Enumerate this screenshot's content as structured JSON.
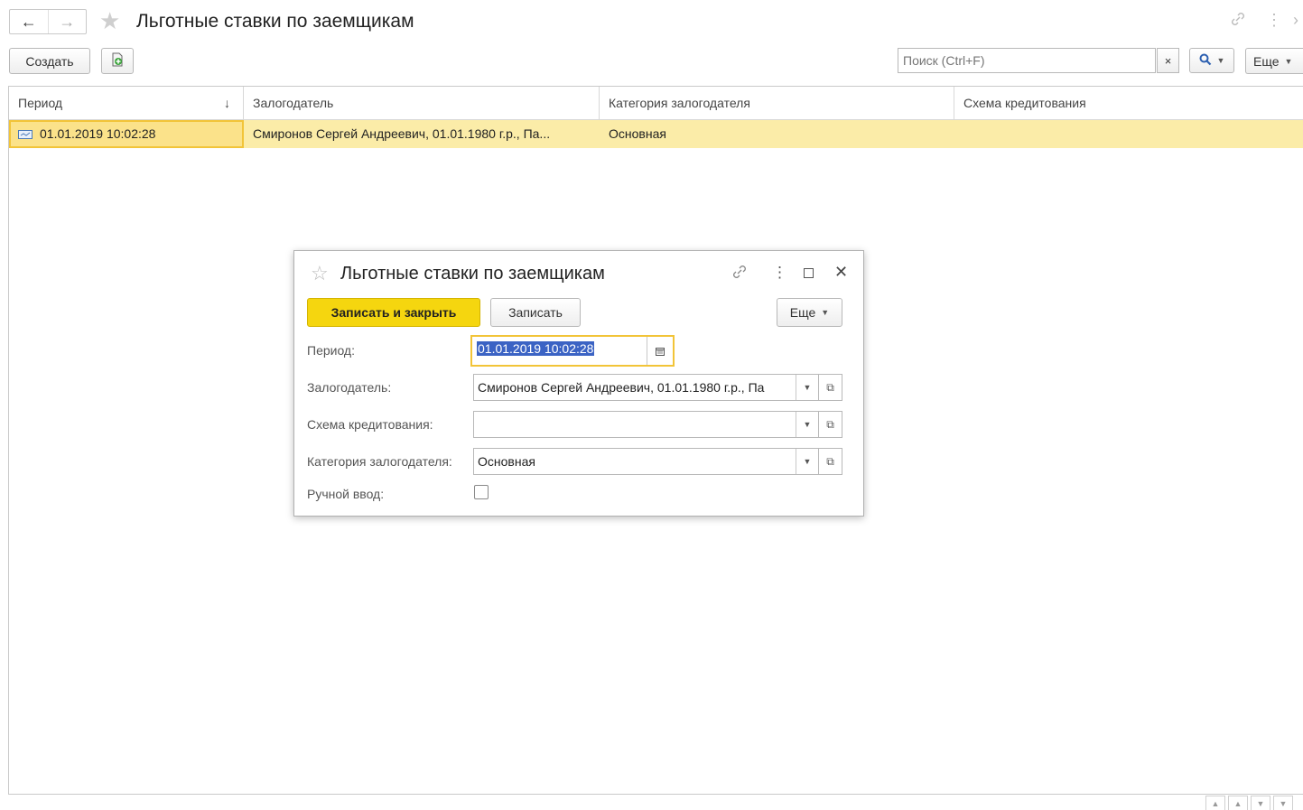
{
  "window": {
    "title": "Льготные ставки по заемщикам"
  },
  "toolbar": {
    "create_label": "Создать",
    "search_placeholder": "Поиск (Ctrl+F)",
    "clear_symbol": "×",
    "more_label": "Еще"
  },
  "table": {
    "columns": [
      "Период",
      "Залогодатель",
      "Категория залогодателя",
      "Схема кредитования"
    ],
    "sort_indicator": "↓",
    "rows": [
      {
        "period": "01.01.2019 10:02:28",
        "pledger": "Смиронов Сергей Андреевич, 01.01.1980 г.р., Па...",
        "category": "Основная",
        "scheme": ""
      }
    ]
  },
  "dialog": {
    "title": "Льготные ставки по заемщикам",
    "save_close_label": "Записать и закрыть",
    "save_label": "Записать",
    "more_label": "Еще",
    "fields": {
      "period_label": "Период:",
      "period_value": "01.01.2019 10:02:28",
      "pledger_label": "Залогодатель:",
      "pledger_value": "Смиронов Сергей Андреевич, 01.01.1980 г.р., Па",
      "scheme_label": "Схема кредитования:",
      "scheme_value": "",
      "category_label": "Категория залогодателя:",
      "category_value": "Основная",
      "manual_label": "Ручной ввод:"
    }
  },
  "colors": {
    "accent_yellow": "#f5d60f",
    "selected_row": "#fbeca8",
    "selection_text_bg": "#3b63c4"
  }
}
